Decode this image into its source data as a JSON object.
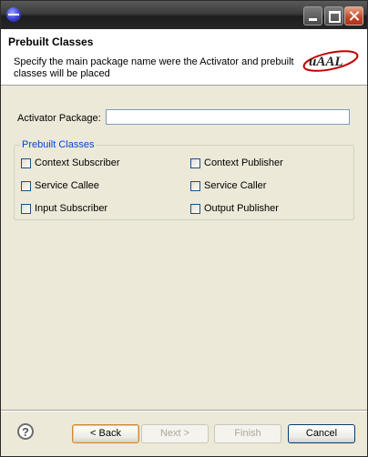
{
  "header": {
    "title": "Prebuilt Classes",
    "description": "Specify the main package name were the Activator and prebuilt classes will be placed",
    "logo_text": "uAAL"
  },
  "activator": {
    "label": "Activator Package:",
    "value": ""
  },
  "group": {
    "legend": "Prebuilt Classes",
    "options": [
      {
        "label": "Context Subscriber",
        "checked": false
      },
      {
        "label": "Context Publisher",
        "checked": false
      },
      {
        "label": "Service Callee",
        "checked": false
      },
      {
        "label": "Service Caller",
        "checked": false
      },
      {
        "label": "Input Subscriber",
        "checked": false
      },
      {
        "label": "Output Publisher",
        "checked": false
      }
    ]
  },
  "buttons": {
    "back": "< Back",
    "next": "Next >",
    "finish": "Finish",
    "cancel": "Cancel",
    "help": "?"
  }
}
